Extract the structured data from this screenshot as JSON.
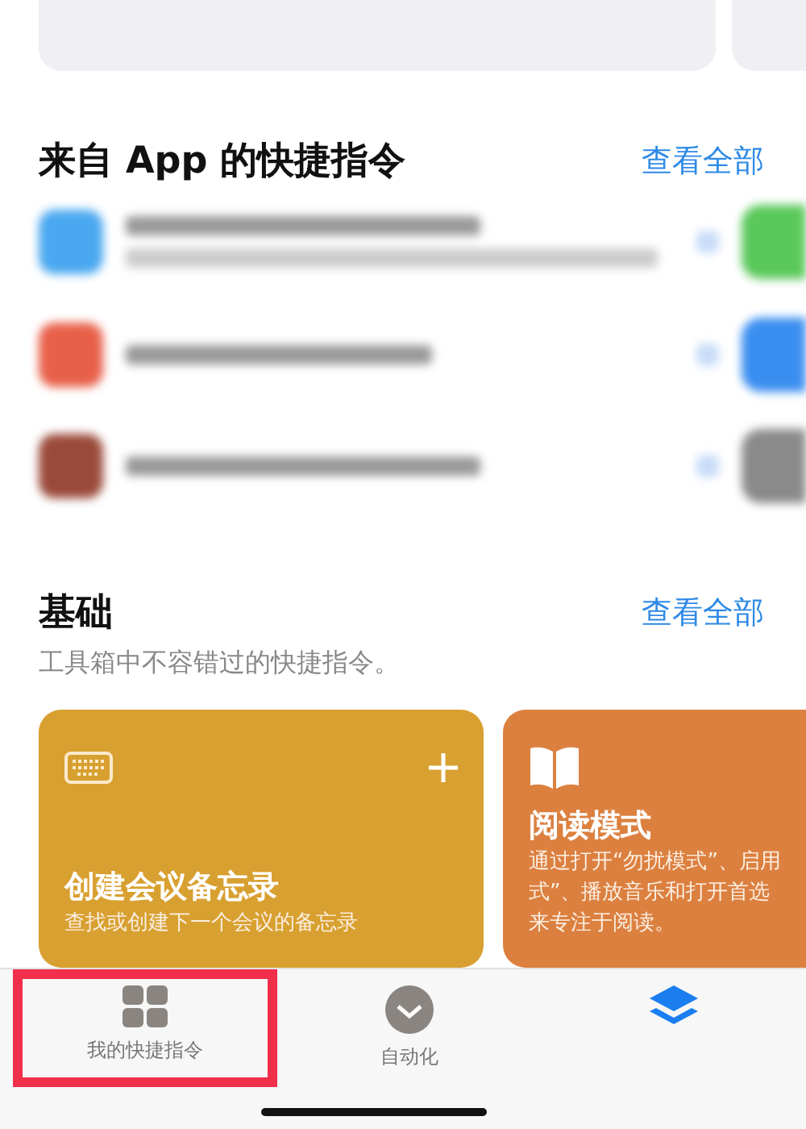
{
  "app_section": {
    "title": "来自 App 的快捷指令",
    "link": "查看全部",
    "rows": [
      {
        "color": "#4aa8f0",
        "kind": "two_line",
        "action": {
          "color": "#5ac85a"
        }
      },
      {
        "color": "#e8604a",
        "kind": "one_line",
        "action": {
          "color": "#3a8ef0"
        }
      },
      {
        "color": "#9a4a3a",
        "kind": "one_line",
        "action": {
          "color": "#8a8a8a"
        }
      }
    ]
  },
  "basics": {
    "title": "基础",
    "link": "查看全部",
    "subtitle": "工具箱中不容错过的快捷指令。",
    "cards": [
      {
        "kind": "keyboard",
        "color": "#d8a030",
        "title": "创建会议备忘录",
        "lines": [
          "查找或创建下一个会议的备忘录"
        ],
        "has_add": true
      },
      {
        "kind": "book",
        "color": "#dc8040",
        "title": "阅读模式",
        "lines": [
          "通过打开“勿扰模式”、启用",
          "式”、播放音乐和打开首选",
          "来专注于阅读。"
        ],
        "has_add": false
      }
    ]
  },
  "tab_bar": [
    {
      "kind": "grid",
      "label": "我的快捷指令",
      "selected": false,
      "highlighted": true
    },
    {
      "kind": "check",
      "label": "自动化",
      "selected": false,
      "highlighted": false
    },
    {
      "kind": "layers",
      "selected": true,
      "highlighted": false
    }
  ]
}
